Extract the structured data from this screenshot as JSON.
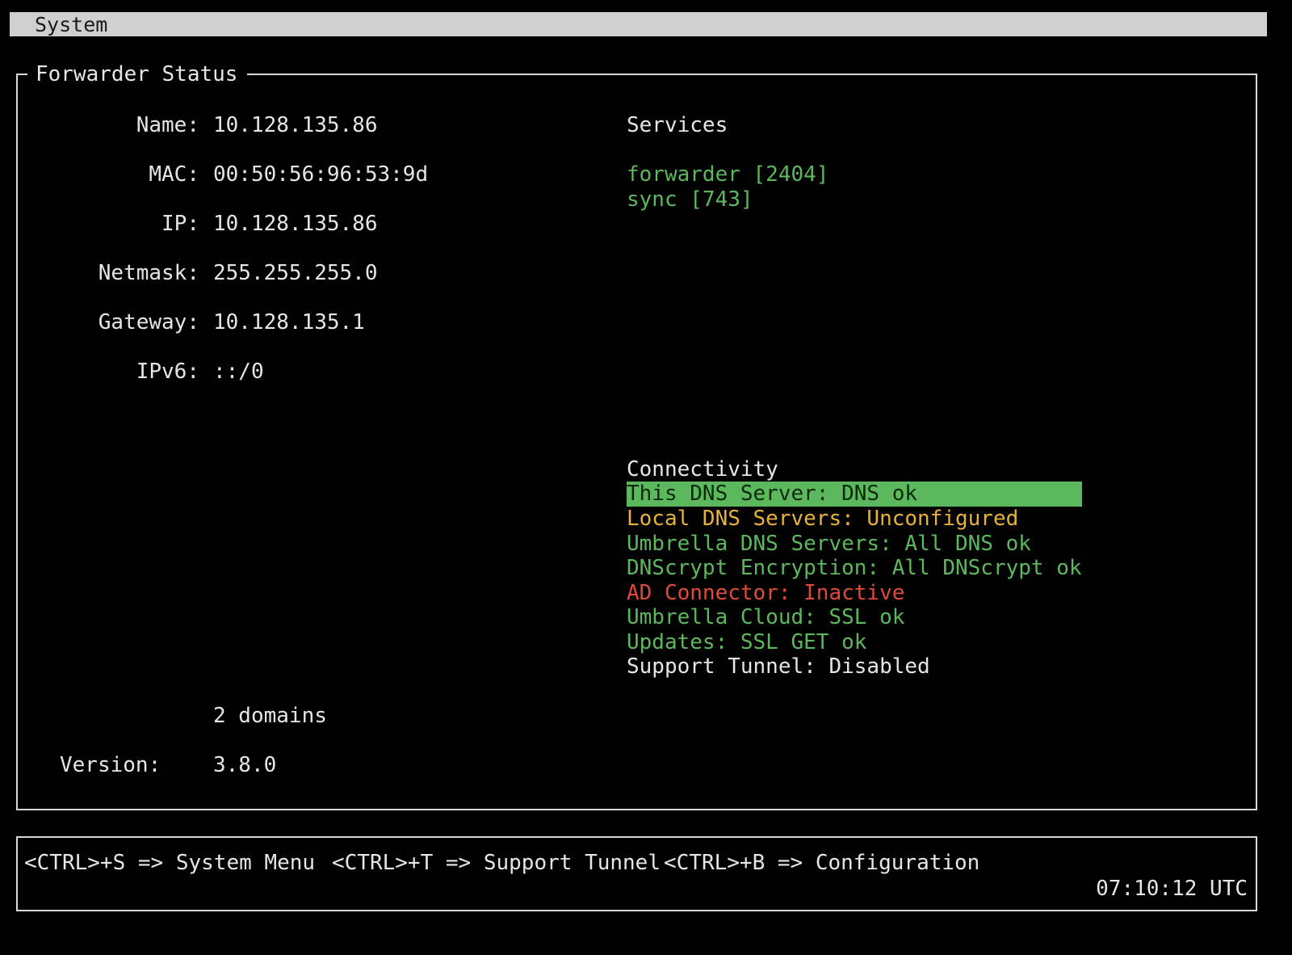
{
  "menubar": {
    "title": "System"
  },
  "panel": {
    "title": "Forwarder Status",
    "fields": [
      {
        "label": "Name:",
        "value": "10.128.135.86"
      },
      {
        "label": "MAC:",
        "value": "00:50:56:96:53:9d"
      },
      {
        "label": "IP:",
        "value": "10.128.135.86"
      },
      {
        "label": "Netmask:",
        "value": "255.255.255.0"
      },
      {
        "label": "Gateway:",
        "value": "10.128.135.1"
      },
      {
        "label": "IPv6:",
        "value": "::/0"
      }
    ],
    "domains": "2 domains",
    "version": {
      "label": "Version:",
      "value": "3.8.0"
    }
  },
  "services": {
    "heading": "Services",
    "items": [
      "forwarder [2404]",
      "sync [743]"
    ]
  },
  "connectivity": {
    "heading": "Connectivity",
    "items": [
      {
        "text": "This DNS Server: DNS ok",
        "status": "ok-selected",
        "color": "#5cb85c"
      },
      {
        "text": "Local DNS Servers: Unconfigured",
        "status": "warning",
        "color": "#e8b13a"
      },
      {
        "text": "Umbrella DNS Servers: All DNS ok",
        "status": "ok",
        "color": "#5bb85b"
      },
      {
        "text": "DNScrypt Encryption: All DNScrypt ok",
        "status": "ok",
        "color": "#5bb85b"
      },
      {
        "text": "AD Connector: Inactive",
        "status": "error",
        "color": "#e04a3a"
      },
      {
        "text": "Umbrella Cloud: SSL ok",
        "status": "ok",
        "color": "#5bb85b"
      },
      {
        "text": "Updates: SSL GET ok",
        "status": "ok",
        "color": "#5bb85b"
      },
      {
        "text": "Support Tunnel: Disabled",
        "status": "neutral",
        "color": "#e6e6e6"
      }
    ]
  },
  "hints": {
    "system_menu": "<CTRL>+S => System Menu",
    "support_tunnel": "<CTRL>+T => Support Tunnel",
    "configuration": "<CTRL>+B => Configuration"
  },
  "clock": "07:10:12 UTC"
}
